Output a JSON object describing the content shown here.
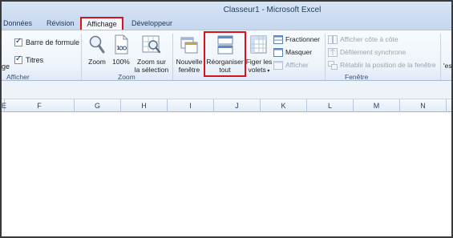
{
  "window": {
    "title": "Classeur1  -  Microsoft Excel"
  },
  "tabs": [
    {
      "label": "Données"
    },
    {
      "label": "Révision"
    },
    {
      "label": "Affichage"
    },
    {
      "label": "Développeur"
    }
  ],
  "ribbon": {
    "afficher": {
      "left_partial": "ge",
      "barre_formule": "Barre de formule",
      "titres": "Titres",
      "label": "Afficher"
    },
    "zoom": {
      "zoom": "Zoom",
      "cent": "100%",
      "zoom_selection_1": "Zoom sur",
      "zoom_selection_2": "la sélection",
      "label": "Zoom"
    },
    "fenetre": {
      "nouvelle_1": "Nouvelle",
      "nouvelle_2": "fenêtre",
      "reorganiser_1": "Réorganiser",
      "reorganiser_2": "tout",
      "figer_1": "Figer les",
      "figer_2": "volets",
      "fractionner": "Fractionner",
      "masquer": "Masquer",
      "afficher": "Afficher",
      "cote_a_cote": "Afficher côte à côte",
      "defilement": "Défilement synchrone",
      "retablir": "Rétablir la position de la fenêtre",
      "right_partial": "'es",
      "label": "Fenêtre"
    }
  },
  "sheet": {
    "columns": [
      "E",
      "F",
      "G",
      "H",
      "I",
      "J",
      "K",
      "L",
      "M",
      "N"
    ]
  },
  "colors": {
    "highlight": "#d6121d",
    "ribbon": "#eef4fb",
    "title_text": "#253b5c"
  }
}
